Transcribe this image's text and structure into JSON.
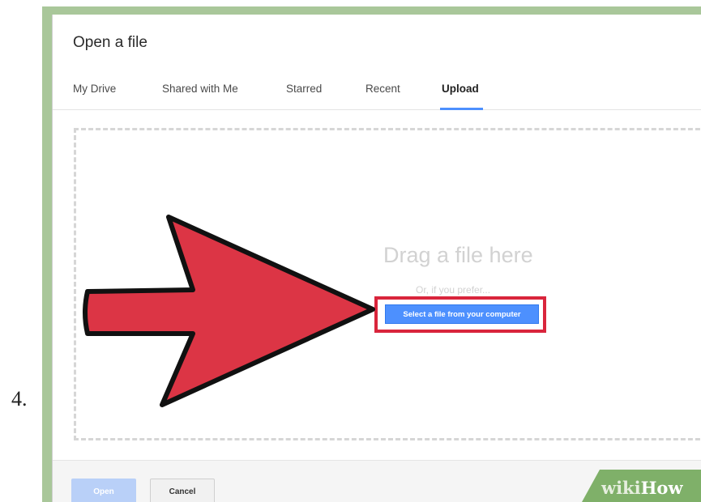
{
  "step": {
    "number": "4."
  },
  "dialog": {
    "title": "Open a file",
    "tabs": [
      {
        "label": "My Drive",
        "active": false
      },
      {
        "label": "Shared with Me",
        "active": false
      },
      {
        "label": "Starred",
        "active": false
      },
      {
        "label": "Recent",
        "active": false
      },
      {
        "label": "Upload",
        "active": true
      }
    ],
    "dropzone": {
      "heading": "Drag a file here",
      "subtext": "Or, if you prefer...",
      "select_button_label": "Select a file from your computer"
    },
    "footer": {
      "open_label": "Open",
      "cancel_label": "Cancel"
    }
  },
  "watermark": {
    "wiki": "wiki",
    "how": "How"
  },
  "colors": {
    "accent": "#4d90fe",
    "highlight": "#d9253c",
    "arrow": "#dc3545",
    "frame": "#a9c79a"
  }
}
